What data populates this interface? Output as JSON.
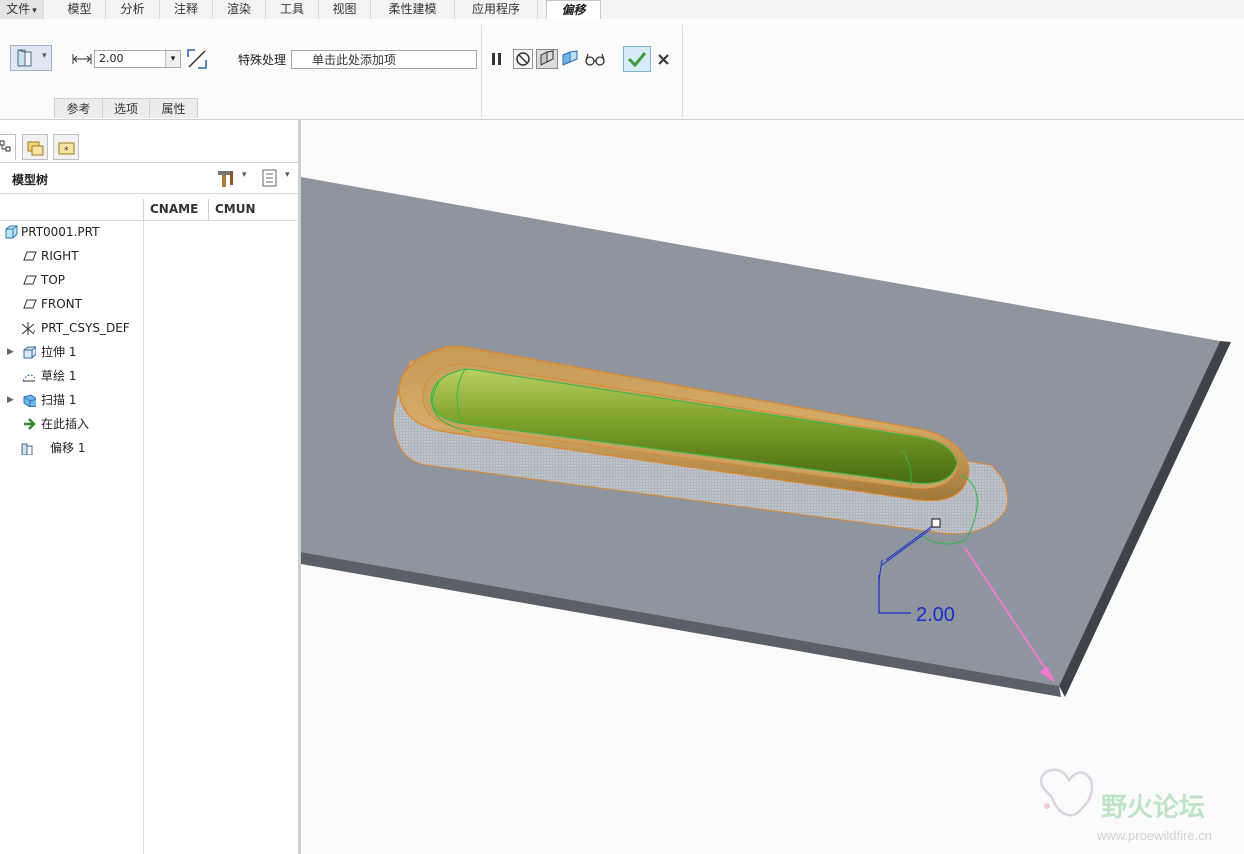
{
  "menubar": {
    "tabs": [
      {
        "label": "文件",
        "has_arrow": true
      },
      {
        "label": "模型"
      },
      {
        "label": "分析"
      },
      {
        "label": "注释"
      },
      {
        "label": "渲染"
      },
      {
        "label": "工具"
      },
      {
        "label": "视图"
      },
      {
        "label": "柔性建模"
      },
      {
        "label": "应用程序"
      },
      {
        "label": "偏移",
        "active": true
      }
    ],
    "file_arrow": "▾"
  },
  "ribbon": {
    "offset_value": "2.00",
    "special_label": "特殊处理",
    "special_placeholder": "单击此处添加项",
    "subtabs": [
      "参考",
      "选项",
      "属性"
    ],
    "accent_ok": "#3d9b3d"
  },
  "model_tree": {
    "title": "模型树",
    "columns": [
      "CNAME",
      "CMUN"
    ],
    "items": [
      {
        "label": "PRT0001.PRT",
        "icon": "part-icon",
        "expandable": false
      },
      {
        "label": "RIGHT",
        "icon": "datum-plane-icon",
        "expandable": false
      },
      {
        "label": "TOP",
        "icon": "datum-plane-icon",
        "expandable": false
      },
      {
        "label": "FRONT",
        "icon": "datum-plane-icon",
        "expandable": false
      },
      {
        "label": "PRT_CSYS_DEF",
        "icon": "csys-icon",
        "expandable": false
      },
      {
        "label": "拉伸 1",
        "icon": "extrude-icon",
        "expandable": true
      },
      {
        "label": "草绘 1",
        "icon": "sketch-icon",
        "expandable": false
      },
      {
        "label": "扫描 1",
        "icon": "sweep-icon",
        "expandable": true
      },
      {
        "label": "在此插入",
        "icon": "insert-here-icon",
        "expandable": false
      },
      {
        "label": "偏移 1",
        "icon": "offset-feature-icon",
        "expandable": false
      }
    ],
    "expander_glyph": "▶"
  },
  "viewport": {
    "dimension_label": "2.00"
  },
  "watermark": {
    "name": "野火论坛",
    "url": "www.proewildfire.cn"
  }
}
